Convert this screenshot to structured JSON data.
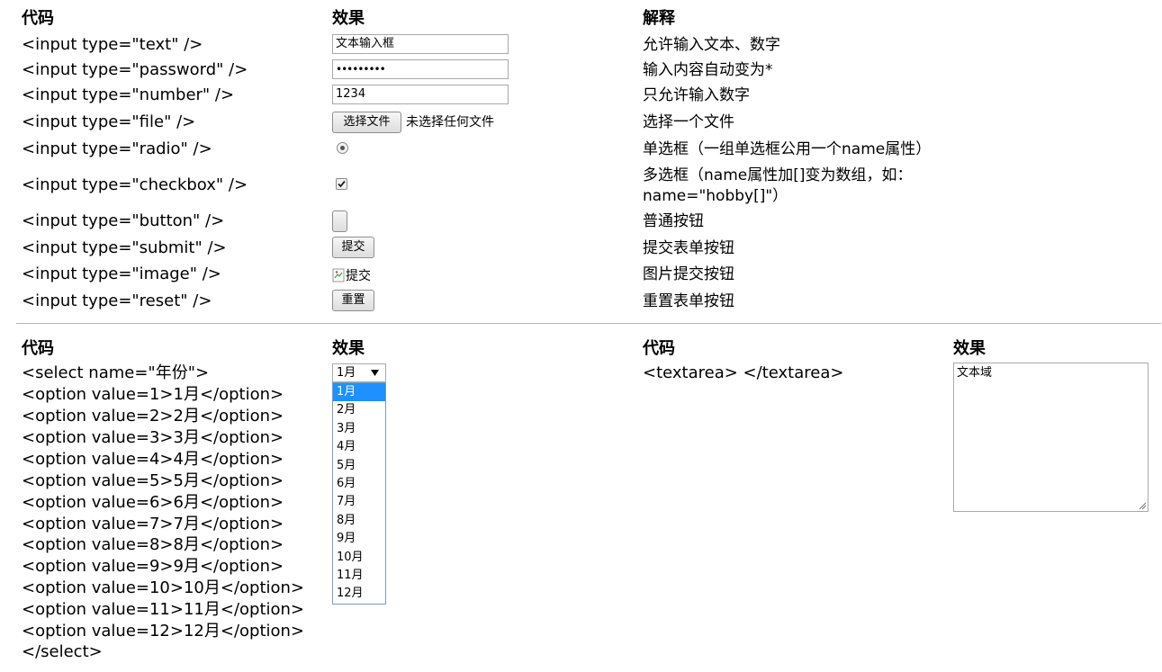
{
  "top": {
    "headers": {
      "code": "代码",
      "effect": "效果",
      "desc": "解释"
    },
    "rows": [
      {
        "code": "<input type=\"text\" />",
        "desc": "允许输入文本、数字"
      },
      {
        "code": "<input type=\"password\" />",
        "desc": "输入内容自动变为*"
      },
      {
        "code": "<input type=\"number\" />",
        "desc": "只允许输入数字"
      },
      {
        "code": "<input type=\"file\" />",
        "desc": "选择一个文件"
      },
      {
        "code": "<input type=\"radio\" />",
        "desc": "单选框（一组单选框公用一个name属性）"
      },
      {
        "code": "<input type=\"checkbox\" />",
        "desc": "多选框（name属性加[]变为数组，如：",
        "desc2": "name=\"hobby[]\"）"
      },
      {
        "code": "<input type=\"button\" />",
        "desc": "普通按钮"
      },
      {
        "code": "<input type=\"submit\" />",
        "desc": "提交表单按钮"
      },
      {
        "code": "<input type=\"image\" />",
        "desc": "图片提交按钮"
      },
      {
        "code": "<input type=\"reset\" />",
        "desc": "重置表单按钮"
      }
    ],
    "effects": {
      "text_value": "文本输入框",
      "password_value": "•••••••••",
      "number_value": "1234",
      "file_button": "选择文件",
      "file_status": "未选择任何文件",
      "radio_checked": true,
      "checkbox_checked": true,
      "submit_label": "提交",
      "image_alt": "提交",
      "reset_label": "重置"
    }
  },
  "bottom": {
    "headers": {
      "code": "代码",
      "effect": "效果",
      "code2": "代码",
      "effect2": "效果"
    },
    "select_code": [
      "<select name=\"年份\">",
      "<option value=1>1月</option>",
      "<option value=2>2月</option>",
      "<option value=3>3月</option>",
      "<option value=4>4月</option>",
      "<option value=5>5月</option>",
      "<option value=6>6月</option>",
      "<option value=7>7月</option>",
      "<option value=8>8月</option>",
      "<option value=9>9月</option>",
      "<option value=10>10月</option>",
      "<option value=11>11月</option>",
      "<option value=12>12月</option>",
      "</select>"
    ],
    "select_value": "1月",
    "select_options": [
      "1月",
      "2月",
      "3月",
      "4月",
      "5月",
      "6月",
      "7月",
      "8月",
      "9月",
      "10月",
      "11月",
      "12月"
    ],
    "selected_index": 0,
    "textarea_code": "<textarea> </textarea>",
    "textarea_value": "文本域"
  },
  "colors": {
    "highlight": "#1e90ff",
    "rule": "#b5b5b5",
    "border": "#a9a9a9"
  }
}
